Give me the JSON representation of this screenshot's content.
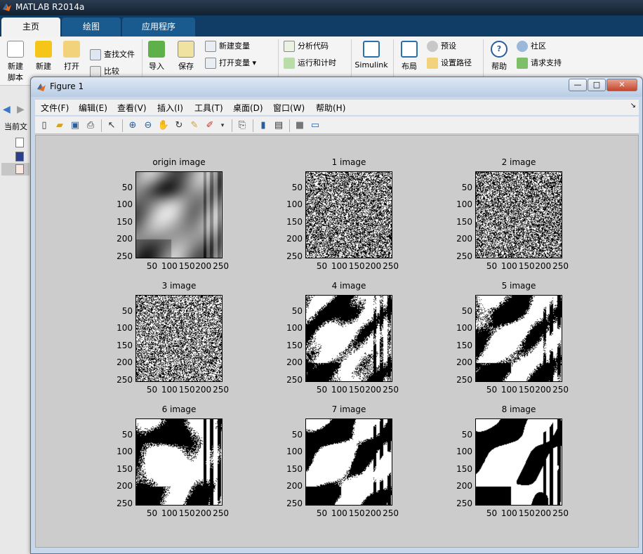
{
  "app": {
    "title": "MATLAB R2014a"
  },
  "main_tabs": [
    {
      "label": "主页",
      "active": true
    },
    {
      "label": "绘图",
      "active": false
    },
    {
      "label": "应用程序",
      "active": false
    }
  ],
  "ribbon": {
    "new_script": "新建\n脚本",
    "new": "新建",
    "open": "打开",
    "find_files": "查找文件",
    "compare": "比较",
    "import": "导入",
    "save": "保存",
    "new_variable": "新建变量",
    "open_variable": "打开变量",
    "analyze_code": "分析代码",
    "run_and_time": "运行和计时",
    "simulink": "Simulink",
    "layout": "布局",
    "preferences": "预设",
    "set_path": "设置路径",
    "help": "帮助",
    "community": "社区",
    "request_support": "请求支持"
  },
  "left_panel": {
    "current_folder_label": "当前文"
  },
  "figure": {
    "title": "Figure 1",
    "menu": [
      "文件(F)",
      "编辑(E)",
      "查看(V)",
      "插入(I)",
      "工具(T)",
      "桌面(D)",
      "窗口(W)",
      "帮助(H)"
    ],
    "window_buttons": {
      "minimize": "—",
      "maximize": "□",
      "close": "✕"
    },
    "toolbar_icons": [
      "new-figure-icon",
      "open-file-icon",
      "save-icon",
      "print-icon",
      "pointer-icon",
      "zoom-in-icon",
      "zoom-out-icon",
      "pan-icon",
      "rotate-icon",
      "data-cursor-icon",
      "brush-icon",
      "link-icon",
      "colorbar-icon",
      "legend-icon",
      "hide-plot-tools-icon",
      "show-plot-tools-icon"
    ]
  },
  "axes": [
    {
      "title": "origin image",
      "kind": "grayscale"
    },
    {
      "title": "1 image",
      "kind": "noise"
    },
    {
      "title": "2 image",
      "kind": "noise"
    },
    {
      "title": "3 image",
      "kind": "noise-light"
    },
    {
      "title": "4 image",
      "kind": "bitplane-4"
    },
    {
      "title": "5 image",
      "kind": "bitplane-5"
    },
    {
      "title": "6 image",
      "kind": "bitplane-6"
    },
    {
      "title": "7 image",
      "kind": "bitplane-7"
    },
    {
      "title": "8 image",
      "kind": "bitplane-8"
    }
  ],
  "axis_ticks": {
    "y": [
      "50",
      "100",
      "150",
      "200",
      "250"
    ],
    "x": [
      "50",
      "100",
      "150",
      "200",
      "250"
    ]
  },
  "colors": {
    "tab_bar": "#0f3d66",
    "canvas": "#cccccc"
  }
}
